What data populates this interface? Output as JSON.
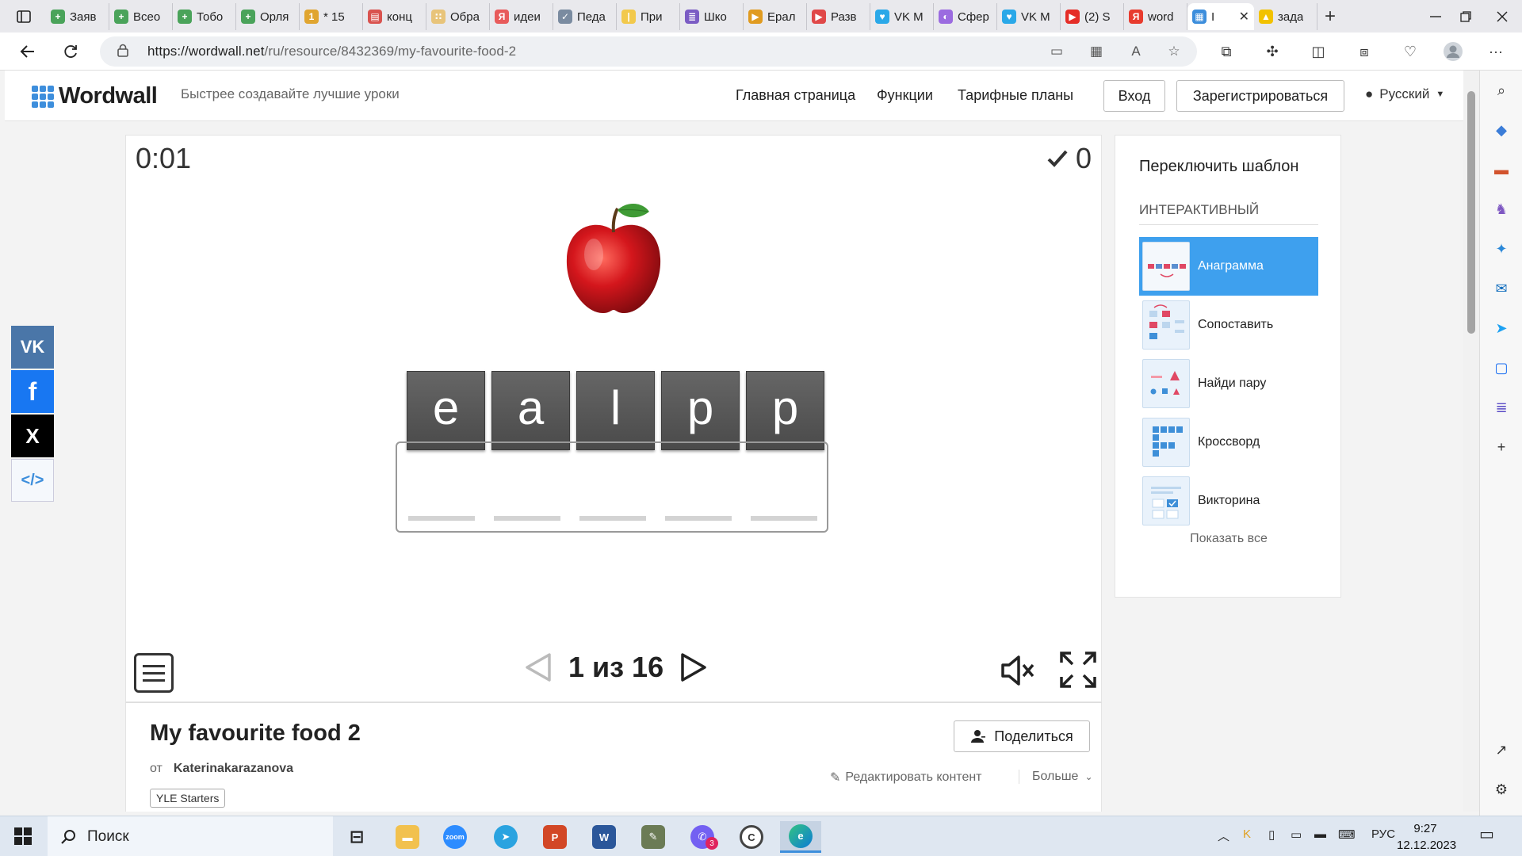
{
  "browser": {
    "tabs": [
      {
        "title": "Заяв",
        "color": "#4aa35a",
        "glyph": "+"
      },
      {
        "title": "Всео",
        "color": "#4aa35a",
        "glyph": "+"
      },
      {
        "title": "Тобо",
        "color": "#4aa35a",
        "glyph": "+"
      },
      {
        "title": "Орля",
        "color": "#4aa35a",
        "glyph": "+"
      },
      {
        "title": "* 15",
        "color": "#e0a530",
        "glyph": "1"
      },
      {
        "title": "конц",
        "color": "#d9534f",
        "glyph": "▤"
      },
      {
        "title": "Обра",
        "color": "#e8c47a",
        "glyph": "∷"
      },
      {
        "title": "идеи",
        "color": "#e85b5b",
        "glyph": "Я"
      },
      {
        "title": "Педа",
        "color": "#7a8ba0",
        "glyph": "✓"
      },
      {
        "title": "При",
        "color": "#f2c94c",
        "glyph": "|"
      },
      {
        "title": "Шко",
        "color": "#7b5cc4",
        "glyph": "≣"
      },
      {
        "title": "Ерал",
        "color": "#e09b20",
        "glyph": "▶"
      },
      {
        "title": "Разв",
        "color": "#e04848",
        "glyph": "▶"
      },
      {
        "title": "VK M",
        "color": "#2aa8e8",
        "glyph": "♥"
      },
      {
        "title": "Сфер",
        "color": "#9b6be0",
        "glyph": "◐"
      },
      {
        "title": "VK M",
        "color": "#2aa8e8",
        "glyph": "♥"
      },
      {
        "title": "(2) S",
        "color": "#e52d27",
        "glyph": "▶"
      },
      {
        "title": "word",
        "color": "#e83b2e",
        "glyph": "Я"
      }
    ],
    "active_tab_title": "I",
    "active_tab_color": "#3d8edc",
    "last_tab_title": "зада",
    "new_tab": "+",
    "url_scheme_host": "https://wordwall.net",
    "url_path": "/ru/resource/8432369/my-favourite-food-2"
  },
  "header": {
    "logo": "Wordwall",
    "tagline": "Быстрее создавайте лучшие уроки",
    "nav": [
      "Главная страница",
      "Функции",
      "Тарифные планы"
    ],
    "login": "Вход",
    "register": "Зарегистрироваться",
    "language": "Русский"
  },
  "game": {
    "timer": "0:01",
    "score": "0",
    "letters": [
      "e",
      "a",
      "l",
      "p",
      "p"
    ],
    "page": "1 из 16"
  },
  "activity": {
    "title": "My favourite food 2",
    "by_label": "от",
    "author": "Katerinakarazanova",
    "tag": "YLE Starters",
    "share": "Поделиться",
    "edit": "Редактировать контент",
    "more": "Больше"
  },
  "templates": {
    "title": "Переключить шаблон",
    "section": "ИНТЕРАКТИВНЫЙ",
    "items": [
      "Анаграмма",
      "Сопоставить",
      "Найди пару",
      "Кроссворд",
      "Викторина"
    ],
    "show_all": "Показать все"
  },
  "social": {
    "vk": "VK",
    "facebook": "f",
    "x": "X",
    "embed": "</>",
    "colors": {
      "vk": "#4a76a8",
      "facebook": "#1877f2",
      "x": "#000000",
      "embed": "#f5f8fc"
    }
  },
  "taskbar": {
    "search": "Поиск",
    "lang": "РУС",
    "time": "9:27",
    "date": "12.12.2023",
    "viber_badge": "3"
  },
  "colors": {
    "accent": "#3ea0ee",
    "tile": "#4a4a4a"
  }
}
